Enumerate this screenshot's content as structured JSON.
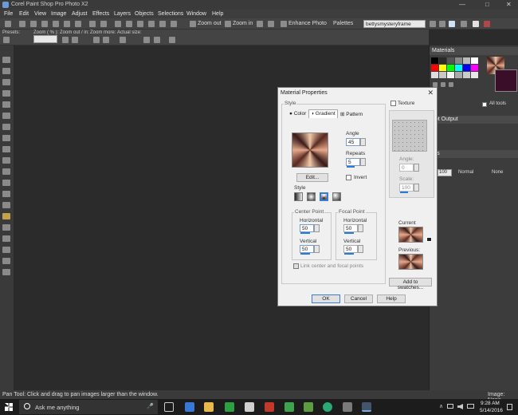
{
  "window": {
    "title": "Corel Paint Shop Pro Photo X2",
    "minimize": "—",
    "maximize": "□",
    "close": "✕"
  },
  "menu": [
    "File",
    "Edit",
    "View",
    "Image",
    "Adjust",
    "Effects",
    "Layers",
    "Objects",
    "Selections",
    "Window",
    "Help"
  ],
  "toolbar": {
    "zoom_out": "Zoom out",
    "zoom_in": "Zoom in",
    "enhance_photo": "Enhance Photo",
    "palettes": "Palettes",
    "document": "bettysmysteryframe"
  },
  "tool_options": {
    "presets": "Presets:",
    "zoom_pct": "Zoom ( % ):",
    "zoom_out_in": "Zoom out / in:",
    "zoom_more": "Zoom more:",
    "actual_size": "Actual size:"
  },
  "panels": {
    "materials": "Materials",
    "all_tools": "All tools",
    "script_output": "ript Output",
    "layers": "ers",
    "layer_opacity": "100",
    "blend_mode": "Normal",
    "none": "None"
  },
  "dialog": {
    "title": "Material Properties",
    "close": "✕",
    "style_group": "Style",
    "tabs": {
      "color": "Color",
      "gradient": "Gradient",
      "pattern": "Pattern"
    },
    "angle_label": "Angle",
    "angle_value": "45",
    "repeats_label": "Repeats",
    "repeats_value": "5",
    "invert_label": "Invert",
    "edit_button": "Edit...",
    "style_label": "Style",
    "center_point": "Center Point",
    "focal_point": "Focal Point",
    "horizontal": "Horizontal",
    "vertical": "Vertical",
    "center_h": "50",
    "center_v": "50",
    "focal_h": "50",
    "focal_v": "50",
    "link_label": "Link center and focal points",
    "texture_label": "Texture",
    "tex_angle_label": "Angle:",
    "tex_angle_value": "0",
    "scale_label": "Scale:",
    "scale_value": "100",
    "current_label": "Current",
    "previous_label": "Previous:",
    "add_swatches": "Add to swatches...",
    "ok": "OK",
    "cancel": "Cancel",
    "help": "Help"
  },
  "status": {
    "left": "Pan Tool: Click and drag to pan images larger than the window.",
    "right": "Image: None"
  },
  "taskbar": {
    "search": "Ask me anything",
    "time": "9:28 AM",
    "date": "5/14/2016",
    "mic": "🎤",
    "up_arrow": "∧"
  }
}
